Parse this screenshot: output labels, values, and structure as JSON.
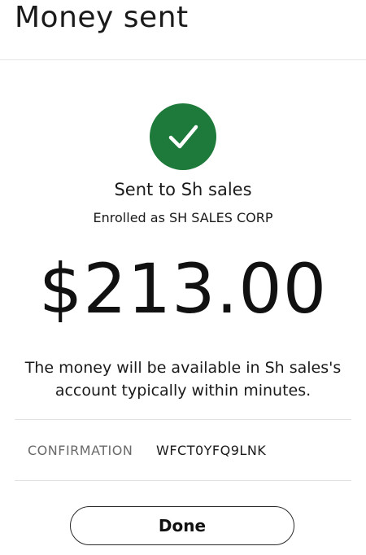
{
  "header": {
    "title": "Money sent"
  },
  "status": {
    "icon": "checkmark-icon",
    "color": "#1e7a3a"
  },
  "recipient": {
    "sent_to": "Sent to Sh sales",
    "enrolled_as": "Enrolled as SH SALES CORP"
  },
  "payment": {
    "amount": "$213.00",
    "availability_note": "The money will be available in Sh sales's account typically within minutes."
  },
  "confirmation": {
    "label": "CONFIRMATION",
    "number": "WFCT0YFQ9LNK"
  },
  "actions": {
    "done_label": "Done"
  }
}
